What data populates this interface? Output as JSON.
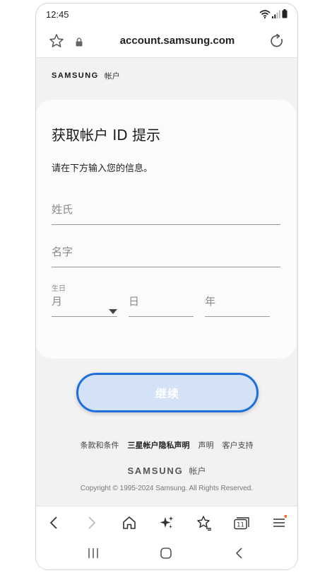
{
  "status_bar": {
    "time": "12:45"
  },
  "browser": {
    "url": "account.samsung.com"
  },
  "brand": {
    "logo_text": "SAMSUNG",
    "account_label": "帐户"
  },
  "form": {
    "title": "获取帐户 ID 提示",
    "subtitle": "请在下方输入您的信息。",
    "last_name_placeholder": "姓氏",
    "first_name_placeholder": "名字",
    "birthday_label": "生日",
    "month_placeholder": "月",
    "day_placeholder": "日",
    "year_placeholder": "年",
    "continue_label": "继续"
  },
  "footer": {
    "links": [
      "条款和条件",
      "三星帐户隐私声明",
      "声明",
      "客户支持"
    ],
    "logo_text": "SAMSUNG",
    "account_label": "帐户",
    "copyright": "Copyright © 1995-2024 Samsung. All Rights Reserved."
  },
  "icons": {
    "status": [
      "wifi-icon",
      "signal-icon",
      "battery-icon"
    ],
    "browser": [
      "bookmark-star-icon",
      "lock-icon",
      "reload-icon"
    ],
    "toolbar": [
      "back-icon",
      "forward-icon",
      "home-icon",
      "ai-sparkle-icon",
      "bookmarks-icon",
      "tabs-icon",
      "menu-icon"
    ],
    "nav": [
      "recents-icon",
      "home-nav-icon",
      "back-nav-icon"
    ]
  },
  "colors": {
    "accent": "#1e6fd9",
    "button_fill": "#d3e2f6",
    "notification_dot": "#f07030"
  },
  "tabs_count": "11"
}
